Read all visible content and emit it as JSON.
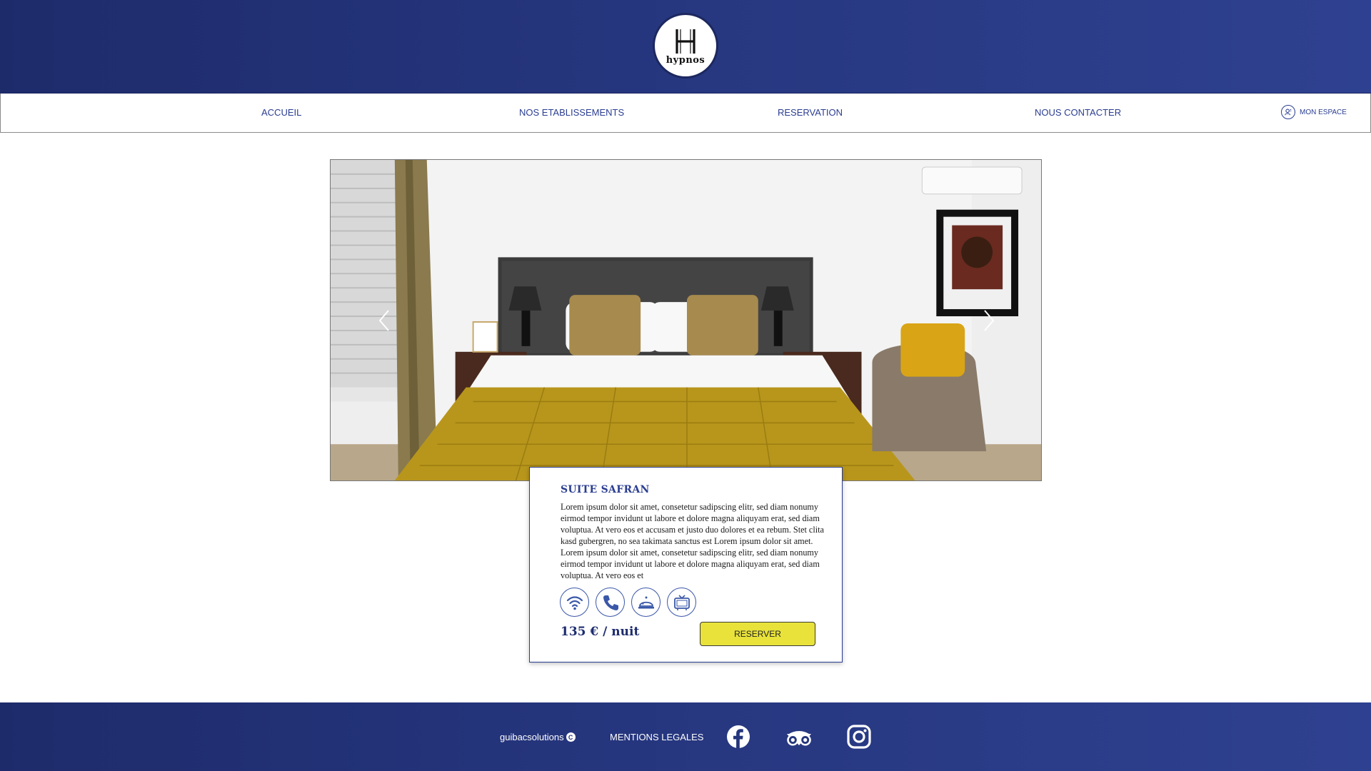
{
  "brand": {
    "name": "hypnos",
    "monogram": "H"
  },
  "nav": {
    "items": [
      {
        "label": "ACCUEIL"
      },
      {
        "label": "NOS ETABLISSEMENTS"
      },
      {
        "label": "RESERVATION"
      },
      {
        "label": "NOUS CONTACTER"
      }
    ],
    "account_label": "MON ESPACE"
  },
  "carousel": {
    "prev_icon": "chevron-left-icon",
    "next_icon": "chevron-right-icon"
  },
  "room": {
    "title": "SUITE SAFRAN",
    "description": "Lorem ipsum dolor sit amet, consetetur sadipscing elitr, sed diam nonumy eirmod tempor invidunt ut labore et dolore magna aliquyam erat, sed diam voluptua. At vero eos et accusam et justo duo dolores et ea rebum. Stet clita kasd gubergren, no sea takimata sanctus est Lorem ipsum dolor sit amet. Lorem ipsum dolor sit amet, consetetur sadipscing elitr, sed diam nonumy eirmod tempor invidunt ut labore et dolore magna aliquyam erat, sed diam voluptua. At vero eos et",
    "amenities": [
      "wifi-icon",
      "phone-icon",
      "room-service-icon",
      "tv-icon"
    ],
    "price": "135 € / nuit",
    "reserve_label": "RESERVER"
  },
  "footer": {
    "brand": "guibacsolutions",
    "copyright_symbol": "C",
    "legal_label": "MENTIONS LEGALES",
    "socials": [
      "facebook-icon",
      "tripadvisor-icon",
      "instagram-icon"
    ]
  },
  "colors": {
    "primary_blue": "#2a3d91",
    "header_navy": "#25357c",
    "accent_yellow": "#e8e23a",
    "saffron_throw": "#b8961c"
  }
}
